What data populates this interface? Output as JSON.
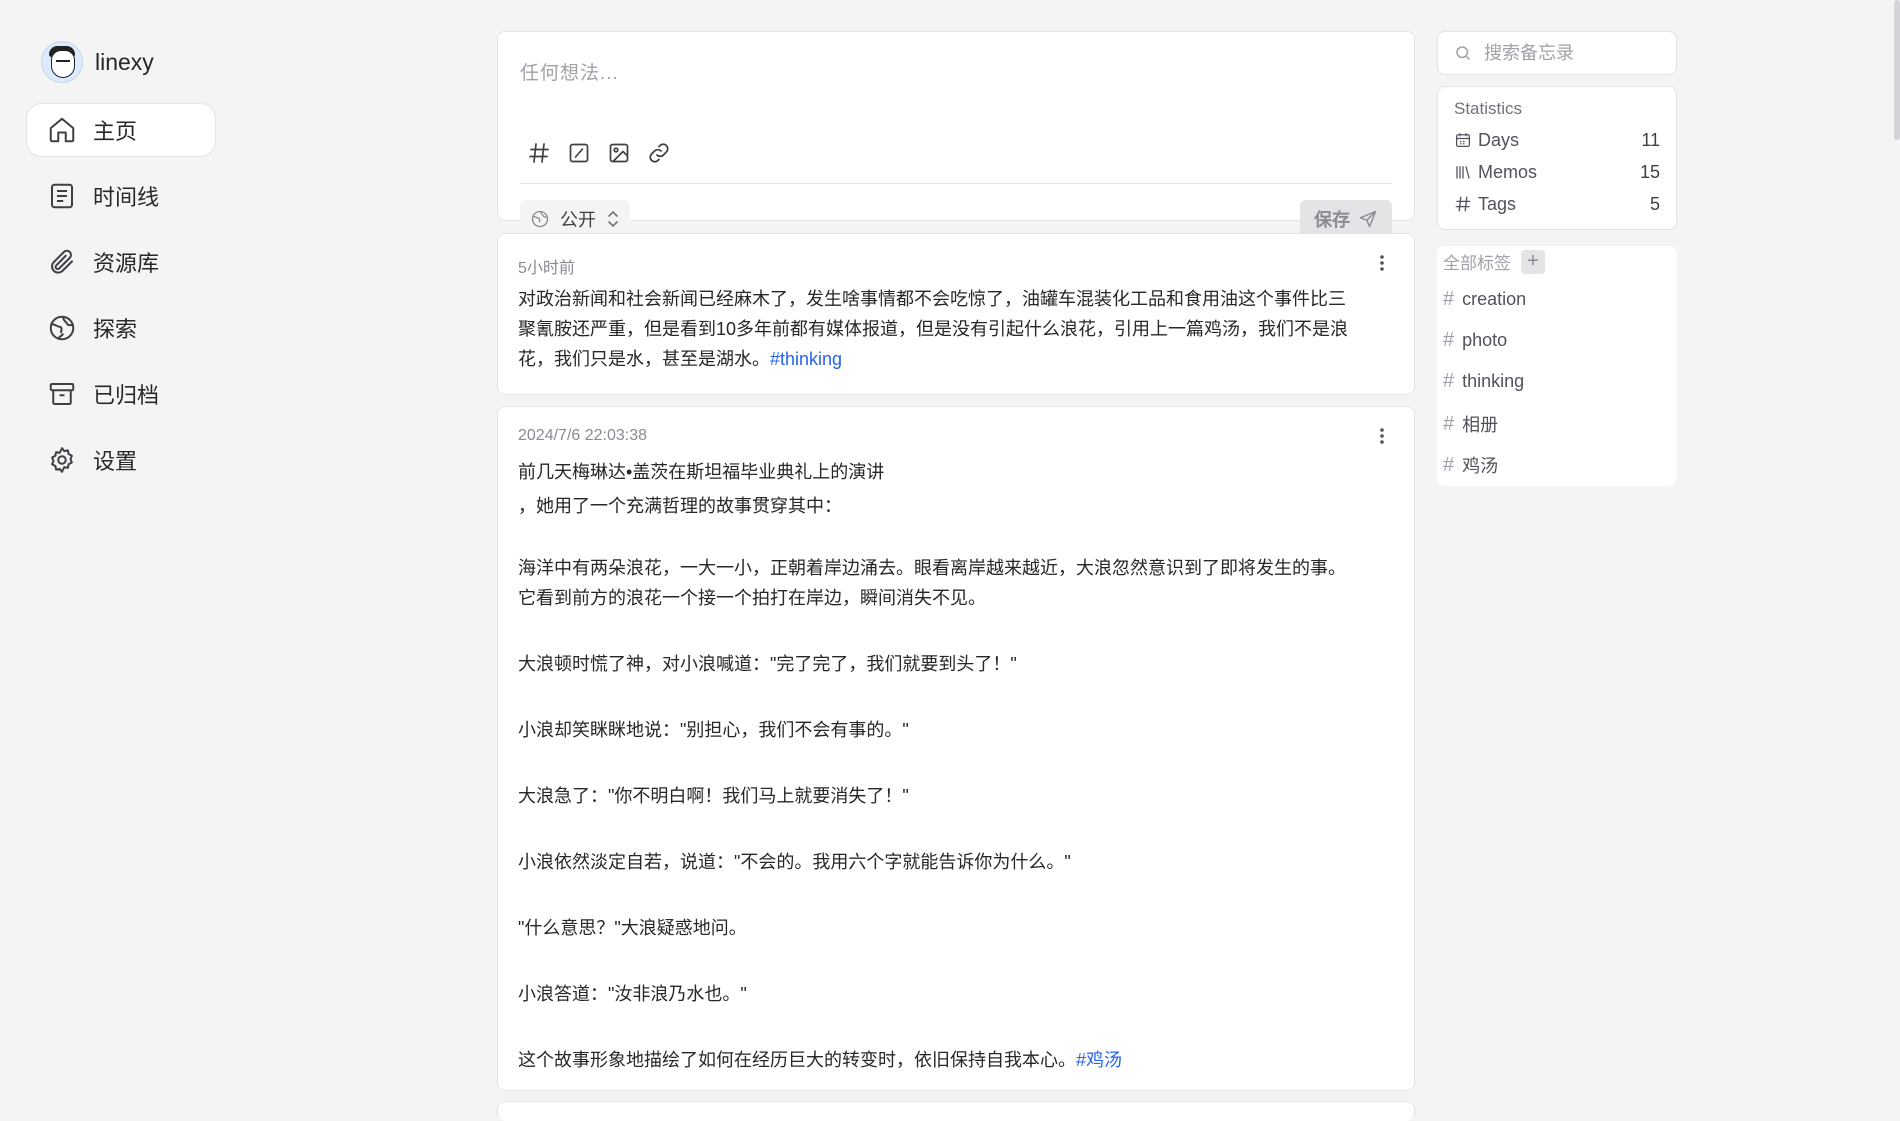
{
  "user": {
    "name": "linexy"
  },
  "nav": [
    {
      "label": "主页",
      "icon": "home-icon",
      "active": true
    },
    {
      "label": "时间线",
      "icon": "timeline-icon"
    },
    {
      "label": "资源库",
      "icon": "paperclip-icon"
    },
    {
      "label": "探索",
      "icon": "explore-icon"
    },
    {
      "label": "已归档",
      "icon": "archive-icon"
    },
    {
      "label": "设置",
      "icon": "gear-icon"
    }
  ],
  "editor": {
    "placeholder": "任何想法...",
    "visibility": "公开",
    "save_label": "保存"
  },
  "memos": [
    {
      "time": "5小时前",
      "lines": [
        "对政治新闻和社会新闻已经麻木了，发生啥事情都不会吃惊了，油罐车混装化工品和食用油这个事件比三",
        "聚氰胺还严重，但是看到10多年前都有媒体报道，但是没有引起什么浪花，引用上一篇鸡汤，我们不是浪",
        "花，我们只是水，甚至是湖水。"
      ],
      "tag": "#thinking"
    },
    {
      "time": "2024/7/6 22:03:38",
      "line1": "前几天梅琳达•盖茨在斯坦福毕业典礼上的演讲",
      "line2": "，她用了一个充满哲理的故事贯穿其中：",
      "p1a": "海洋中有两朵浪花，一大一小，正朝着岸边涌去。眼看离岸越来越近，大浪忽然意识到了即将发生的事。",
      "p1b": "它看到前方的浪花一个接一个拍打在岸边，瞬间消失不见。",
      "p2": "大浪顿时慌了神，对小浪喊道：\"完了完了，我们就要到头了！\"",
      "p3": "小浪却笑眯眯地说：\"别担心，我们不会有事的。\"",
      "p4": "大浪急了：\"你不明白啊！我们马上就要消失了！\"",
      "p5": "小浪依然淡定自若，说道：\"不会的。我用六个字就能告诉你为什么。\"",
      "p6": "\"什么意思？\"大浪疑惑地问。",
      "p7": "小浪答道：\"汝非浪乃水也。\"",
      "p8": "这个故事形象地描绘了如何在经历巨大的转变时，依旧保持自我本心。",
      "tag": "#鸡汤"
    }
  ],
  "search": {
    "placeholder": "搜索备忘录"
  },
  "stats": {
    "title": "Statistics",
    "days_label": "Days",
    "days": "11",
    "memos_label": "Memos",
    "memos": "15",
    "tags_label": "Tags",
    "tags": "5"
  },
  "tags": {
    "title": "全部标签",
    "add": "+",
    "hash": "#",
    "items": [
      "creation",
      "photo",
      "thinking",
      "相册",
      "鸡汤"
    ]
  }
}
